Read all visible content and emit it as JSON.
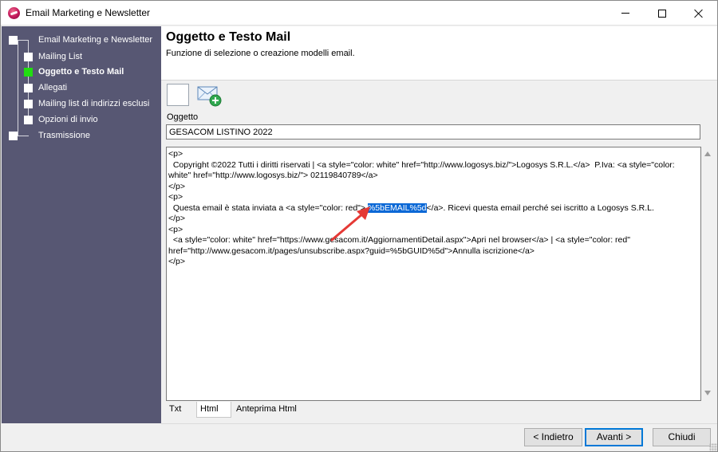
{
  "window": {
    "title": "Email Marketing e Newsletter"
  },
  "sidebar": {
    "items": [
      {
        "label": "Email Marketing e Newsletter",
        "active": false
      },
      {
        "label": "Mailing List",
        "active": false
      },
      {
        "label": "Oggetto e Testo Mail",
        "active": true
      },
      {
        "label": "Allegati",
        "active": false
      },
      {
        "label": "Mailing list di  indirizzi esclusi",
        "active": false
      },
      {
        "label": "Opzioni di invio",
        "active": false
      },
      {
        "label": "Trasmissione",
        "active": false
      }
    ]
  },
  "header": {
    "title": "Oggetto e Testo Mail",
    "subtitle": "Funzione di selezione o creazione modelli email."
  },
  "toolbar": {
    "buttons": [
      "blank-button",
      "add-mail-button"
    ]
  },
  "subject": {
    "label": "Oggetto",
    "value": "GESACOM LISTINO 2022"
  },
  "editor": {
    "line1": "<p>",
    "line2": "  Copyright ©2022 Tutti i diritti riservati | <a style=\"color: white\" href=\"http://www.logosys.biz/\">Logosys S.R.L.</a>  P.Iva: <a style=\"color:",
    "line3": "white\" href=\"http://www.logosys.biz/\"> 02119840789</a>",
    "line4": "</p>",
    "line5": "<p>",
    "line6_before": "  Questa email è stata inviata a <a style=\"color: red\"> ",
    "line6_selected": "%5bEMAIL%5d",
    "line6_after": "</a>. Ricevi questa email perché sei iscritto a Logosys S.R.L.",
    "line7": "</p>",
    "line8": "<p>",
    "line9": "  <a style=\"color: white\" href=\"https://www.gesacom.it/AggiornamentiDetail.aspx\">Apri nel browser</a> | <a style=\"color: red\"",
    "line10": "href=\"http://www.gesacom.it/pages/unsubscribe.aspx?guid=%5bGUID%5d\">Annulla iscrizione</a>",
    "line11": "</p>"
  },
  "tabs": [
    {
      "label": "Txt",
      "active": false
    },
    {
      "label": "Html",
      "active": true
    },
    {
      "label": "Anteprima Html",
      "active": false
    }
  ],
  "footer": {
    "back_label": "< Indietro",
    "next_label": "Avanti >",
    "close_label": "Chiudi"
  },
  "colors": {
    "sidebar_bg": "#575773",
    "active_step": "#22dd11",
    "selection": "#0b68d6",
    "annotation_arrow": "#e53935"
  }
}
